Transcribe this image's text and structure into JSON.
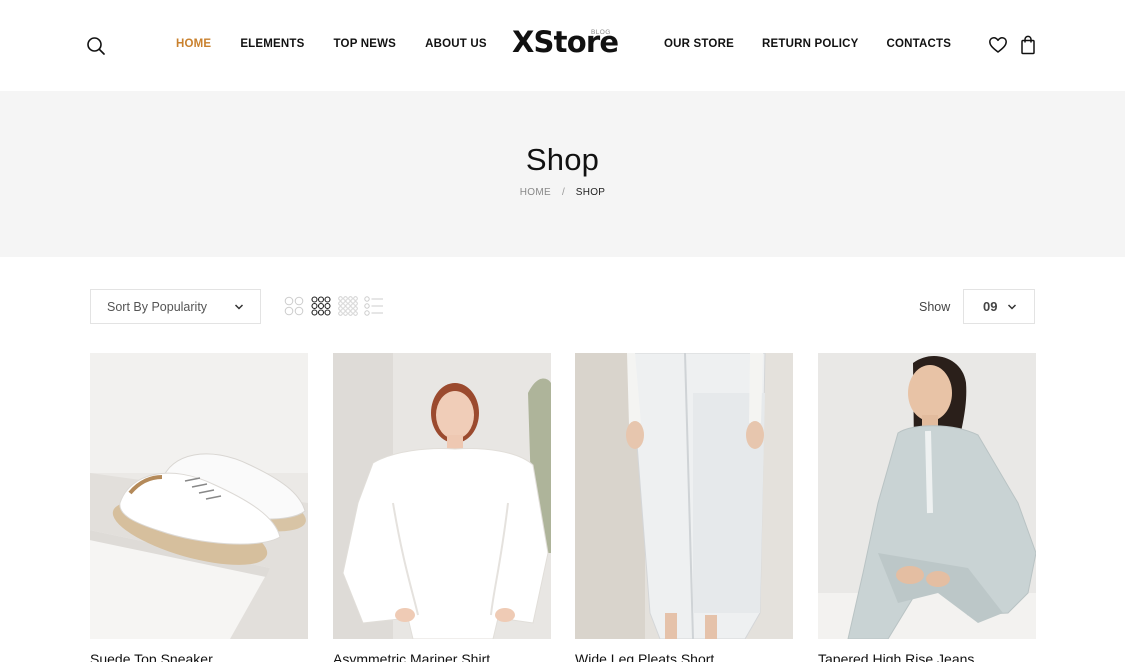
{
  "header": {
    "nav_left": [
      "HOME",
      "ELEMENTS",
      "TOP NEWS",
      "ABOUT US"
    ],
    "nav_right": [
      "OUR STORE",
      "RETURN POLICY",
      "CONTACTS"
    ],
    "logo": "XStore",
    "logo_sup": "BLOG",
    "accent_color": "#c9812e",
    "icons": [
      "search-icon",
      "heart-icon",
      "shopping-bag-icon"
    ]
  },
  "banner": {
    "title": "Shop",
    "breadcrumb": {
      "home": "HOME",
      "separator": "/",
      "current": "SHOP"
    }
  },
  "toolbar": {
    "sort_value": "Sort By Popularity",
    "view_modes": [
      "grid-2-icon",
      "grid-3-icon",
      "grid-4-icon",
      "list-icon"
    ],
    "active_view": "grid-3-icon",
    "show_label": "Show",
    "per_page": "09"
  },
  "products": [
    {
      "title": "Suede Top Sneaker"
    },
    {
      "title": "Asymmetric Mariner Shirt"
    },
    {
      "title": "Wide Leg Pleats Short"
    },
    {
      "title": "Tapered High Rise Jeans"
    }
  ]
}
